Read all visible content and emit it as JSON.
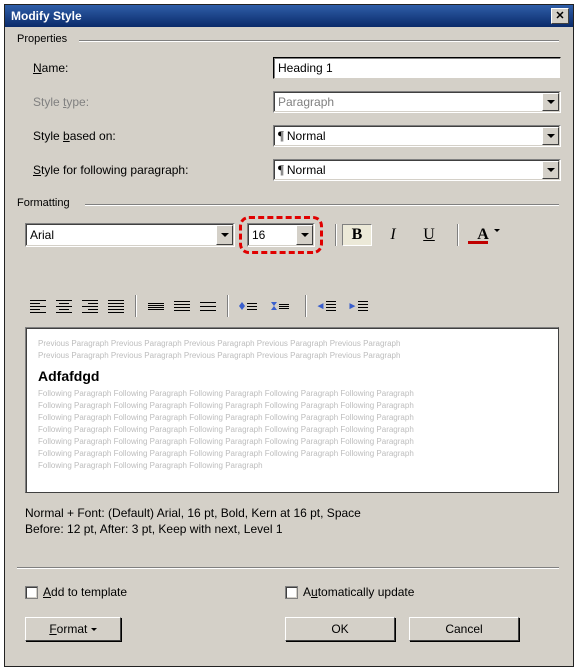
{
  "titlebar": {
    "title": "Modify Style",
    "close": "X"
  },
  "groups": {
    "properties": "Properties",
    "formatting": "Formatting"
  },
  "fields": {
    "name_label": "Name:",
    "name_value": "Heading 1",
    "styletype_label": "Style type:",
    "styletype_value": "Paragraph",
    "basedon_label": "Style based on:",
    "basedon_value": "Normal",
    "following_label": "Style for following paragraph:",
    "following_value": "Normal"
  },
  "format": {
    "font_name": "Arial",
    "font_size": "16",
    "bold": "B",
    "italic": "I",
    "underline": "U",
    "fontcolor_letter": "A"
  },
  "preview": {
    "ghost_prev": "Previous Paragraph Previous Paragraph Previous Paragraph Previous Paragraph Previous Paragraph",
    "sample": "Adfafdgd",
    "ghost_follow": "Following Paragraph Following Paragraph Following Paragraph Following Paragraph Following Paragraph",
    "ghost_follow_short": "Following Paragraph Following Paragraph Following Paragraph"
  },
  "description": {
    "line1": "Normal + Font: (Default) Arial, 16 pt, Bold, Kern at 16 pt, Space",
    "line2": "Before:  12 pt, After:  3 pt, Keep with next, Level 1"
  },
  "footer": {
    "add_template": "Add to template",
    "auto_update": "Automatically update",
    "format_btn": "Format",
    "ok": "OK",
    "cancel": "Cancel"
  }
}
